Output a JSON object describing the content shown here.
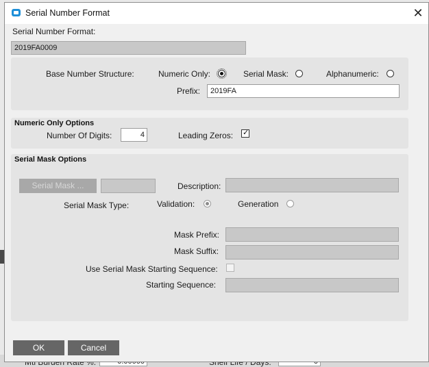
{
  "background": {
    "left_label": "Mtl Burden Rate %:",
    "left_value": "0.00000",
    "right_label": "Shelf Life / Days:",
    "right_value": "0"
  },
  "dialog": {
    "title": "Serial Number Format",
    "close_glyph": "✕",
    "format_label": "Serial Number Format:",
    "format_value": "2019FA0009",
    "base_structure": {
      "label": "Base Number Structure:",
      "options": [
        {
          "label": "Numeric Only:",
          "checked": true
        },
        {
          "label": "Serial Mask:",
          "checked": false
        },
        {
          "label": "Alphanumeric:",
          "checked": false
        }
      ],
      "prefix_label": "Prefix:",
      "prefix_value": "2019FA"
    },
    "numeric_options": {
      "title": "Numeric Only Options",
      "digits_label": "Number Of Digits:",
      "digits_value": "4",
      "leading_zeros_label": "Leading Zeros:",
      "leading_zeros_checked": true,
      "check_glyph": "✓"
    },
    "serial_mask_options": {
      "title": "Serial Mask Options",
      "mask_button": "Serial Mask ...",
      "description_label": "Description:",
      "type_label": "Serial Mask Type:",
      "validation_label": "Validation:",
      "generation_label": "Generation",
      "mask_prefix_label": "Mask Prefix:",
      "mask_suffix_label": "Mask Suffix:",
      "use_starting_label": "Use Serial Mask Starting Sequence:",
      "starting_sequence_label": "Starting Sequence:"
    },
    "ok_label": "OK",
    "cancel_label": "Cancel"
  },
  "colors": {
    "button": "#666666",
    "disabled_field": "#c8c8c8",
    "panel": "#e4e4e4",
    "icon": "#1e8fd8"
  }
}
